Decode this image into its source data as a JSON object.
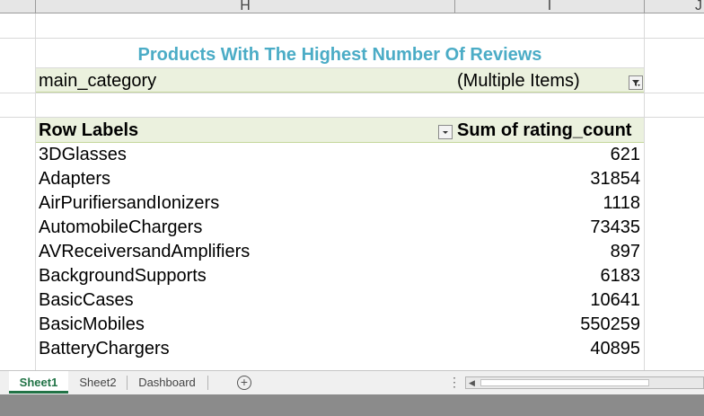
{
  "column_headers": [
    "H",
    "I",
    "J"
  ],
  "pivot": {
    "title": "Products With The Highest Number Of Reviews",
    "filter": {
      "field": "main_category",
      "value": "(Multiple Items)"
    },
    "header": {
      "row_labels": "Row Labels",
      "value_label": "Sum of rating_count"
    },
    "rows": [
      {
        "label": "3DGlasses",
        "value": "621"
      },
      {
        "label": "Adapters",
        "value": "31854"
      },
      {
        "label": "AirPurifiersandIonizers",
        "value": "1118"
      },
      {
        "label": "AutomobileChargers",
        "value": "73435"
      },
      {
        "label": "AVReceiversandAmplifiers",
        "value": "897"
      },
      {
        "label": "BackgroundSupports",
        "value": "6183"
      },
      {
        "label": "BasicCases",
        "value": "10641"
      },
      {
        "label": "BasicMobiles",
        "value": "550259"
      },
      {
        "label": "BatteryChargers",
        "value": "40895"
      }
    ]
  },
  "sheet_tabs": [
    "Sheet1",
    "Sheet2",
    "Dashboard"
  ],
  "active_tab": "Sheet1",
  "colors": {
    "title": "#4bacc6",
    "pivot_band": "#ebf1de",
    "active_tab": "#217346"
  }
}
